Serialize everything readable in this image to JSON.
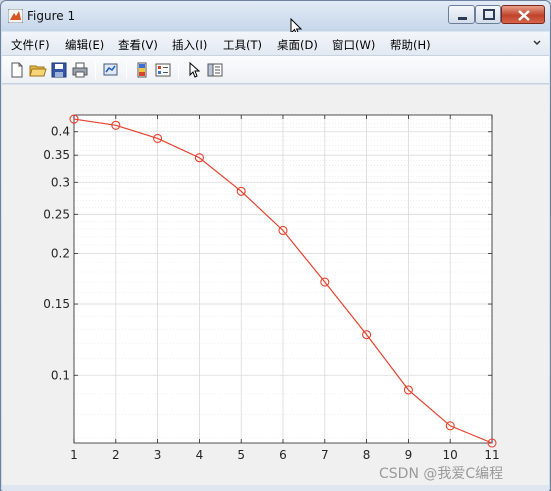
{
  "window": {
    "title": "Figure 1",
    "controls": {
      "minimize": "minimize",
      "maximize": "maximize",
      "close": "close"
    }
  },
  "menu": {
    "items": [
      "文件(F)",
      "编辑(E)",
      "查看(V)",
      "插入(I)",
      "工具(T)",
      "桌面(D)",
      "窗口(W)",
      "帮助(H)"
    ]
  },
  "toolbar": {
    "icons": [
      "new-file-icon",
      "open-folder-icon",
      "save-icon",
      "print-icon",
      "link-plot-icon",
      "insert-colorbar-icon",
      "insert-legend-icon",
      "pointer-icon",
      "property-inspector-icon"
    ]
  },
  "watermark": "CSDN @我爱C编程",
  "chart_data": {
    "type": "line",
    "x": [
      1,
      2,
      3,
      4,
      5,
      6,
      7,
      8,
      9,
      10,
      11
    ],
    "series": [
      {
        "values": [
          0.43,
          0.415,
          0.385,
          0.345,
          0.285,
          0.228,
          0.17,
          0.126,
          0.092,
          0.075,
          0.068
        ]
      }
    ],
    "xlim": [
      1,
      11
    ],
    "ylim": [
      0.068,
      0.44
    ],
    "yscale": "log",
    "xticks": [
      "1",
      "2",
      "3",
      "4",
      "5",
      "6",
      "7",
      "8",
      "9",
      "10",
      "11"
    ],
    "yticks": [
      "0.1",
      "0.15",
      "0.2",
      "0.25",
      "0.3",
      "0.35",
      "0.4"
    ],
    "grid": true,
    "marker": "circle",
    "color": "#e8412c"
  },
  "colors": {
    "line": "#e8412c",
    "grid": "#d9d9d9",
    "axis": "#262626"
  }
}
